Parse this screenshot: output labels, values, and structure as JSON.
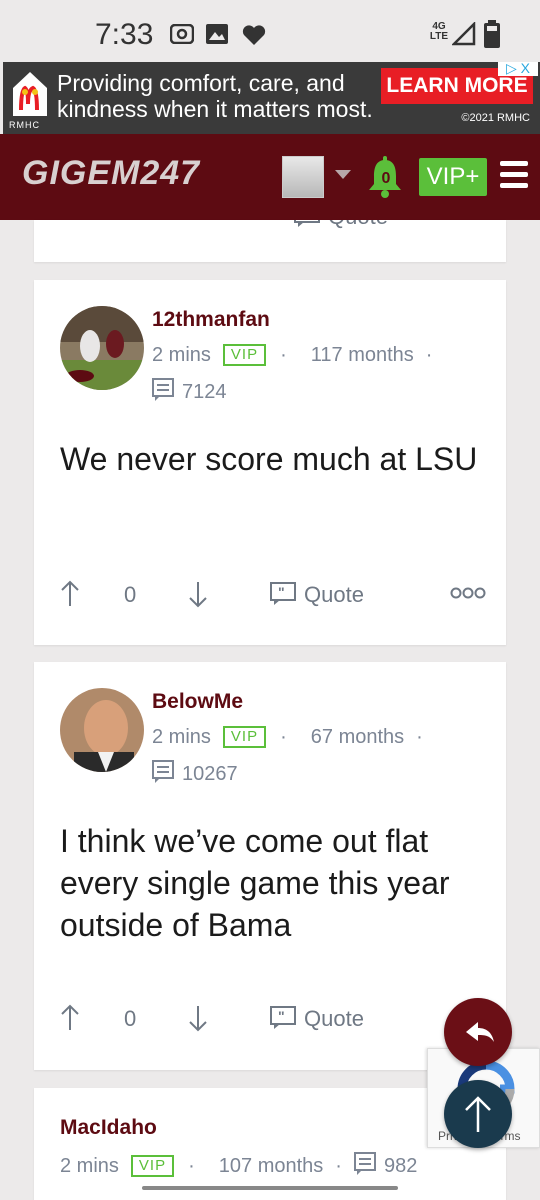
{
  "status": {
    "time": "7:33",
    "network": "4G LTE"
  },
  "ad": {
    "text": "Providing comfort, care, and kindness when it matters most.",
    "cta": "LEARN MORE",
    "copyright": "©2021 RMHC",
    "brand": "RMHC",
    "adchoices": "▷ X"
  },
  "header": {
    "brand": "GIGEM247",
    "notifications": "0",
    "vip_label": "VIP+"
  },
  "prev_post": {
    "quote_label": "Quote"
  },
  "posts": [
    {
      "username": "12thmanfan",
      "time": "2 mins",
      "badge": "VIP",
      "tenure": "117 months",
      "post_count": "7124",
      "body": "We never score much at LSU",
      "upvotes": "0",
      "quote_label": "Quote"
    },
    {
      "username": "BelowMe",
      "time": "2 mins",
      "badge": "VIP",
      "tenure": "67 months",
      "post_count": "10267",
      "body": "I think we’ve come out flat every single game this year outside of Bama",
      "upvotes": "0",
      "quote_label": "Quote"
    },
    {
      "username": "MacIdaho",
      "time": "2 mins",
      "badge": "VIP",
      "tenure": "107 months",
      "post_count": "982"
    }
  ],
  "recaptcha": {
    "text": "Privacy - Terms"
  },
  "colors": {
    "brand_maroon": "#5d0b12",
    "vip_green": "#5bbf3a",
    "ad_red": "#e81e25",
    "meta_gray": "#7c8594"
  }
}
